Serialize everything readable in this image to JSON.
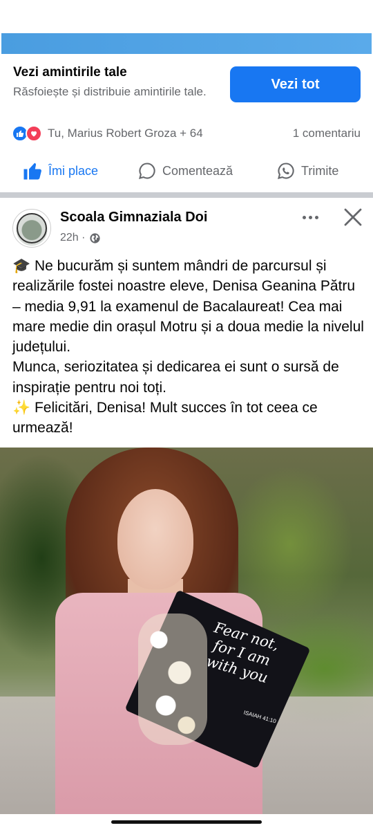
{
  "memories": {
    "title": "Vezi amintirile tale",
    "subtitle": "Răsfoiește și distribuie amintirile tale.",
    "button_label": "Vezi tot"
  },
  "reactions": {
    "names": "Tu, Marius Robert Groza + 64",
    "comments": "1 comentariu"
  },
  "actions": {
    "like": "Îmi place",
    "comment": "Comentează",
    "share": "Trimite"
  },
  "post": {
    "page_name": "Scoala Gimnaziala Doi",
    "time": "22h ·",
    "paragraph1": "🎓 Ne bucurăm și suntem mândri de parcursul și realizările fostei noastre eleve, Denisa Geanina Pătru – media 9,91 la examenul de Bacalaureat! Cea mai mare medie din orașul Motru și a doua medie la nivelul județului.",
    "paragraph2": "Munca, seriozitatea și dedicarea ei sunt o sursă de inspirație pentru noi toți.",
    "paragraph3": "✨ Felicitări, Denisa! Mult succes în tot ceea ce urmează!",
    "photo_cap_text": "Fear not, for I am with you",
    "photo_cap_ref": "ISAIAH 41:10"
  },
  "colors": {
    "brand_blue": "#1877f2",
    "love_red": "#f33e58",
    "secondary_text": "#65676b"
  }
}
